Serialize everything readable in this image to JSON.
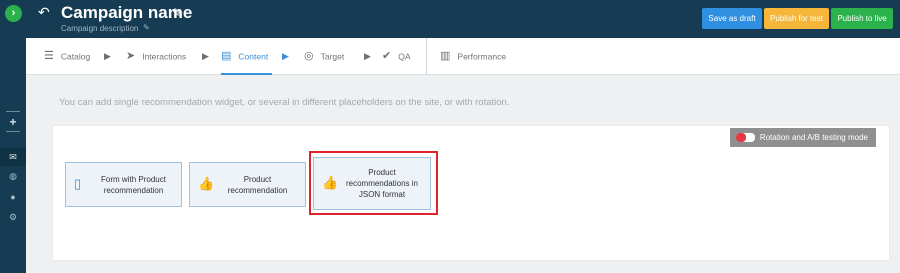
{
  "app": {
    "title": "Campaign name",
    "description": "Campaign description"
  },
  "header": {
    "back_icon": "undo-arrow-icon",
    "edit_icon": "pencil-icon",
    "buttons": {
      "save_draft": "Save as draft",
      "publish_test": "Publish for test",
      "publish_live": "Publish to live"
    },
    "colors": {
      "draft": "#2f8fe0",
      "test": "#f5b63a",
      "live": "#2bb24c",
      "bar": "#153c52"
    }
  },
  "nav": {
    "steps": [
      {
        "label": "Catalog",
        "icon": "database-icon",
        "active": false
      },
      {
        "label": "Interactions",
        "icon": "cursor-icon",
        "active": false
      },
      {
        "label": "Content",
        "icon": "document-icon",
        "active": true
      },
      {
        "label": "Target",
        "icon": "target-icon",
        "active": false
      },
      {
        "label": "QA",
        "icon": "check-circle-icon",
        "active": false
      }
    ],
    "performance": {
      "label": "Performance",
      "icon": "bar-chart-icon"
    },
    "accent": "#3a8fd9"
  },
  "content": {
    "hint": "You can add single recommendation widget, or several in different placeholders on the site, or with rotation.",
    "toggle_label": "Rotation and A/B testing mode",
    "cards": [
      {
        "label": "Form with Product recommendation",
        "icon": "document-icon"
      },
      {
        "label": "Product recommendation",
        "icon": "thumbs-up-icon"
      },
      {
        "label": "Product recommendations in JSON format",
        "icon": "thumbs-up-icon",
        "highlighted": true
      }
    ]
  }
}
